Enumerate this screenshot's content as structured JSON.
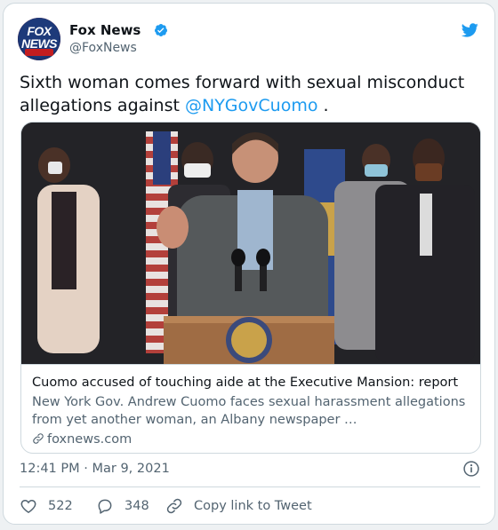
{
  "author": {
    "display_name": "Fox News",
    "handle": "@FoxNews",
    "avatar_icon": "fox-news-logo",
    "avatar_text": "FOX NEWS channel",
    "verified": true
  },
  "tweet": {
    "text_before": "Sixth woman comes forward with sexual misconduct allegations against ",
    "mention": "@NYGovCuomo",
    "text_after": " ."
  },
  "link_card": {
    "title": "Cuomo accused of touching aide at the Executive Mansion: report",
    "description": "New York Gov. Andrew Cuomo faces sexual harassment allegations from yet another woman, an Albany newspaper …",
    "domain": "foxnews.com",
    "image_icon": "press-conference-photo"
  },
  "meta": {
    "timestamp": "12:41 PM · Mar 9, 2021"
  },
  "actions": {
    "likes": "522",
    "replies": "348",
    "copy_link": "Copy link to Tweet"
  },
  "colors": {
    "accent": "#1d9bf0",
    "text": "#0f1419",
    "secondary": "#536471",
    "border": "#cfd9de"
  }
}
